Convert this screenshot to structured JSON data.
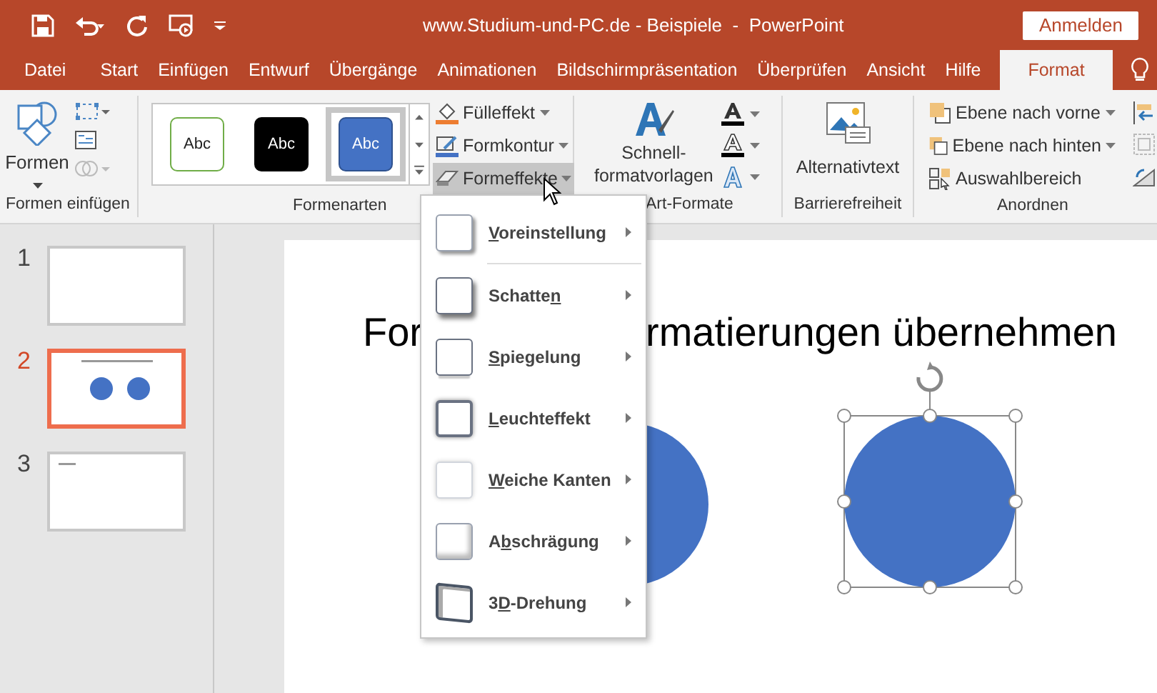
{
  "title_bar": {
    "title": "www.Studium-und-PC.de - Beispiele  -  PowerPoint",
    "sign_in": "Anmelden"
  },
  "tabs": [
    {
      "label": "Datei",
      "selected": false
    },
    {
      "label": "Start",
      "selected": false
    },
    {
      "label": "Einfügen",
      "selected": false
    },
    {
      "label": "Entwurf",
      "selected": false
    },
    {
      "label": "Übergänge",
      "selected": false
    },
    {
      "label": "Animationen",
      "selected": false
    },
    {
      "label": "Bildschirmpräsentation",
      "selected": false
    },
    {
      "label": "Überprüfen",
      "selected": false
    },
    {
      "label": "Ansicht",
      "selected": false
    },
    {
      "label": "Hilfe",
      "selected": false
    },
    {
      "label": "Format",
      "selected": true
    }
  ],
  "ribbon": {
    "insert_shapes": {
      "button": "Formen",
      "label": "Formen einfügen"
    },
    "shape_styles": {
      "label": "Formenarten",
      "styles": [
        {
          "label": "Abc",
          "kind": "outline",
          "selected": false
        },
        {
          "label": "Abc",
          "kind": "dark",
          "selected": false
        },
        {
          "label": "Abc",
          "kind": "filled",
          "selected": true
        }
      ],
      "fill": "Fülleffekt",
      "outline": "Formkontur",
      "effects": {
        "label": "Formeffekte",
        "open": true
      }
    },
    "wordart": {
      "button": "Schnell-\nformatvorlagen",
      "label": "Art-Formate"
    },
    "accessibility": {
      "button": "Alternativtext",
      "label": "Barrierefreiheit"
    },
    "arrange": {
      "items": [
        "Ebene nach vorne",
        "Ebene nach hinten",
        "Auswahlbereich"
      ],
      "label": "Anordnen"
    }
  },
  "slides": [
    {
      "number": "1",
      "selected": false,
      "kind": "blank"
    },
    {
      "number": "2",
      "selected": true,
      "kind": "circles"
    },
    {
      "number": "3",
      "selected": false,
      "kind": "text"
    }
  ],
  "slide": {
    "title_left": "For",
    "title_right": "rmatierungen übernehmen"
  },
  "effects_menu": [
    {
      "key": "V",
      "after": "oreinstellung",
      "kind": "preset"
    },
    {
      "before": "Schatte",
      "key": "n",
      "kind": "shadow"
    },
    {
      "key": "S",
      "after": "piegelung",
      "kind": "reflection"
    },
    {
      "key": "L",
      "after": "euchteffekt",
      "kind": "glow"
    },
    {
      "key": "W",
      "after": "eiche Kanten",
      "kind": "soft"
    },
    {
      "before": "A",
      "key": "b",
      "after": "schrägung",
      "kind": "bevel"
    },
    {
      "before": "3",
      "key": "D",
      "after": "-Drehung",
      "kind": "rotation"
    }
  ]
}
